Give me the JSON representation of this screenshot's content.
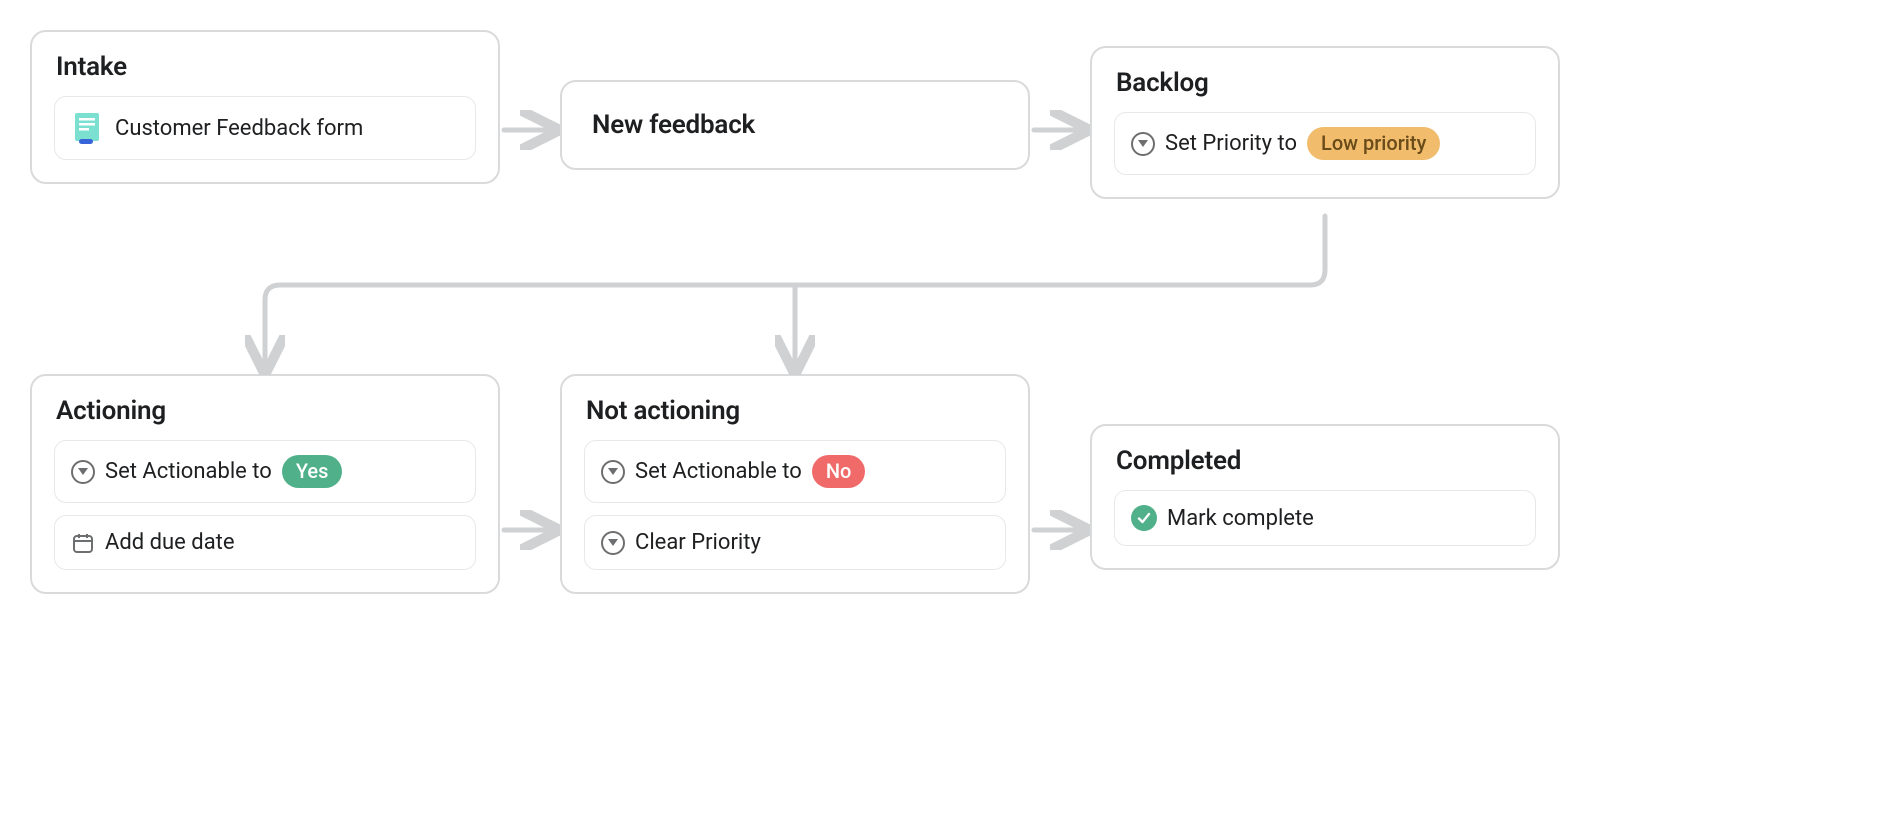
{
  "nodes": {
    "intake": {
      "title": "Intake",
      "form_label": "Customer Feedback form"
    },
    "new_feedback": {
      "title": "New feedback"
    },
    "backlog": {
      "title": "Backlog",
      "set_priority_prefix": "Set Priority to",
      "priority_value": "Low priority"
    },
    "actioning": {
      "title": "Actioning",
      "set_actionable_prefix": "Set Actionable to",
      "actionable_value": "Yes",
      "add_due_date": "Add due date"
    },
    "not_actioning": {
      "title": "Not actioning",
      "set_actionable_prefix": "Set Actionable to",
      "actionable_value": "No",
      "clear_priority": "Clear Priority"
    },
    "completed": {
      "title": "Completed",
      "mark_complete": "Mark complete"
    }
  },
  "colors": {
    "border": "#d9dadb",
    "arrow": "#cfd1d2",
    "pill_green": "#4fb08a",
    "pill_red": "#f06a6a",
    "pill_amber": "#f1bd6c"
  }
}
